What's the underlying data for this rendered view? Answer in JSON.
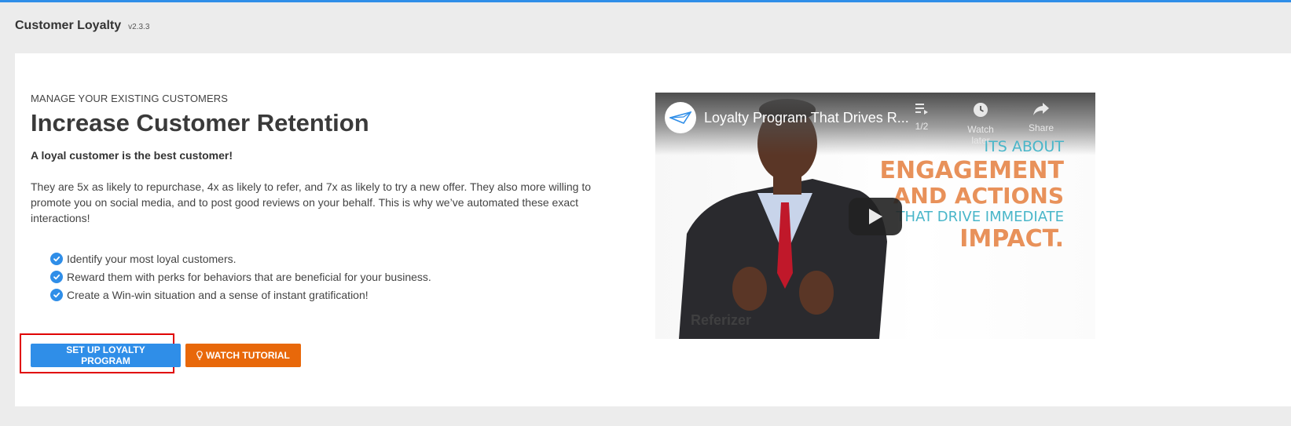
{
  "header": {
    "title": "Customer Loyalty",
    "version": "v2.3.3"
  },
  "hero": {
    "eyebrow": "MANAGE YOUR EXISTING CUSTOMERS",
    "headline": "Increase Customer Retention",
    "tagline": "A loyal customer is the best customer!",
    "description": "They are 5x as likely to repurchase, 4x as likely to refer, and 7x as likely to try a new offer. They also more willing to promote you on social media, and to post good reviews on your behalf. This is why we’ve automated these exact interactions!",
    "benefits": [
      "Identify your most loyal customers.",
      "Reward them with perks for behaviors that are beneficial for your business.",
      "Create a Win-win situation and a sense of instant gratification!"
    ]
  },
  "actions": {
    "setup_label": "SET UP LOYALTY PROGRAM",
    "tutorial_label": "WATCH TUTORIAL"
  },
  "video": {
    "title": "Loyalty Program That Drives R...",
    "playlist_count": "1/2",
    "watch_later_label": "Watch later",
    "share_label": "Share",
    "overlay_lines": [
      "ITS ABOUT",
      "ENGAGEMENT",
      "AND ACTIONS",
      "THAT DRIVE IMMEDIATE",
      "IMPACT."
    ],
    "brand_watermark": "Referizer"
  },
  "colors": {
    "accent_blue": "#2f8ee8",
    "accent_orange": "#e8680a",
    "overlay_teal": "#49b6c9",
    "overlay_orange": "#e8915a",
    "highlight_red": "#e00000"
  },
  "icons": {
    "benefit": "check-circle-icon",
    "tutorial": "lightbulb-icon",
    "playlist": "playlist-icon",
    "watch_later": "clock-icon",
    "share": "share-icon",
    "play": "play-icon"
  }
}
